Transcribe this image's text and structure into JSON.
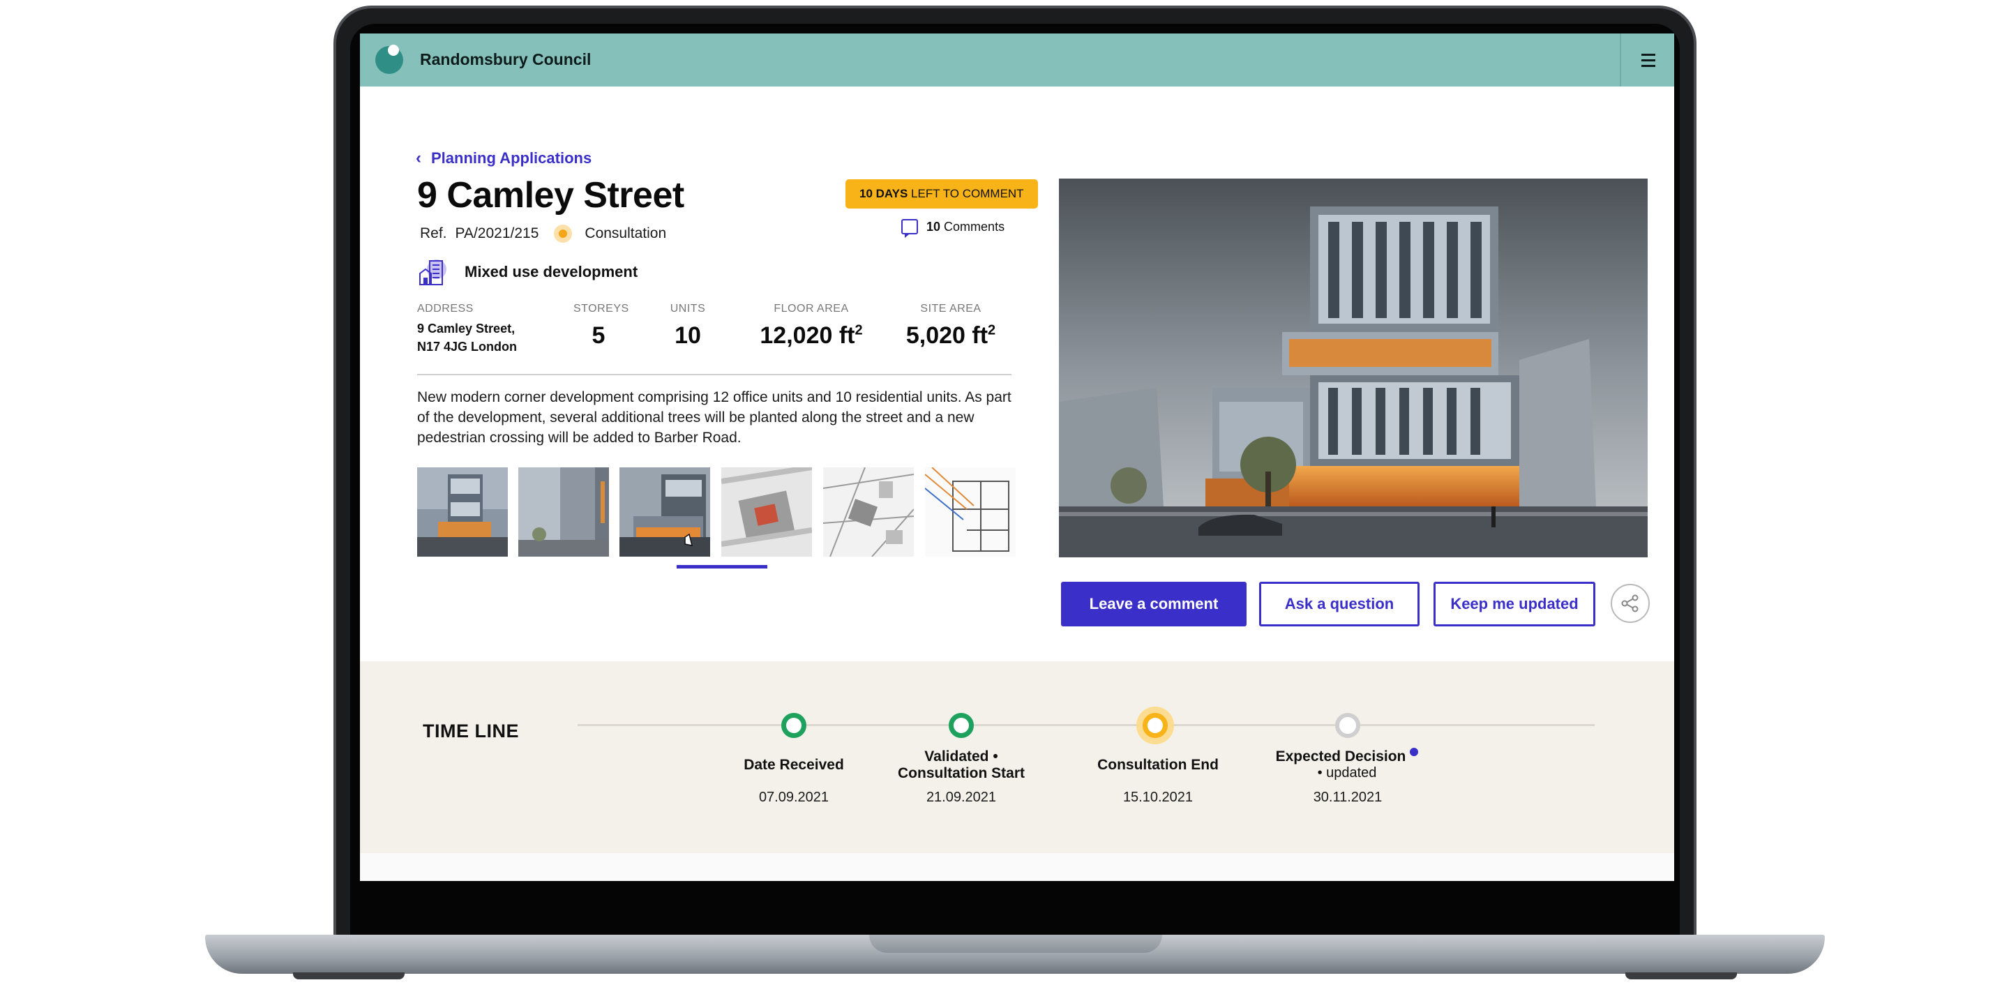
{
  "header": {
    "council_name": "Randomsbury Council",
    "menu_icon": "hamburger-menu-icon",
    "logo_icon": "council-logo-icon"
  },
  "breadcrumb": {
    "back_label": "Planning Applications"
  },
  "application": {
    "title": "9 Camley Street",
    "ref_label": "Ref.",
    "ref_value": "PA/2021/215",
    "status": "Consultation",
    "days_left_bold": "10 DAYS",
    "days_left_rest": "LEFT TO COMMENT",
    "comments_count": "10",
    "comments_label": "Comments",
    "use_type": "Mixed use development",
    "description": "New modern corner development comprising 12 office units and 10 residential units. As part of the development, several additional trees will be planted along the street and a new pedestrian crossing will be added to Barber Road."
  },
  "stats": {
    "address_label": "ADDRESS",
    "address_line1": "9 Camley Street,",
    "address_line2": "N17 4JG London",
    "storeys_label": "STOREYS",
    "storeys_value": "5",
    "units_label": "UNITS",
    "units_value": "10",
    "floor_area_label": "FLOOR AREA",
    "floor_area_value": "12,020 ft",
    "site_area_label": "SITE AREA",
    "site_area_value": "5,020 ft",
    "area_unit_sup": "2"
  },
  "gallery": {
    "selected_index": 2,
    "thumbnails": [
      "render-front",
      "render-side",
      "render-street",
      "site-plan-aerial",
      "site-plan-map",
      "floor-plan"
    ]
  },
  "actions": {
    "leave_comment": "Leave a comment",
    "ask_question": "Ask a question",
    "keep_updated": "Keep me updated",
    "share_icon": "share-icon"
  },
  "timeline": {
    "title": "TIME LINE",
    "steps": [
      {
        "label": "Date Received",
        "sub": "",
        "date": "07.09.2021",
        "state": "done"
      },
      {
        "label": "Validated •",
        "sub": "Consultation Start",
        "date": "21.09.2021",
        "state": "done"
      },
      {
        "label": "Consultation End",
        "sub": "",
        "date": "15.10.2021",
        "state": "current"
      },
      {
        "label": "Expected Decision",
        "sub": "• updated",
        "date": "30.11.2021",
        "state": "future"
      }
    ]
  },
  "colors": {
    "header": "#86c0bb",
    "accent": "#3b2fc9",
    "badge": "#f8b318",
    "done": "#1ea15d",
    "timeline_bg": "#f4f1ea"
  }
}
